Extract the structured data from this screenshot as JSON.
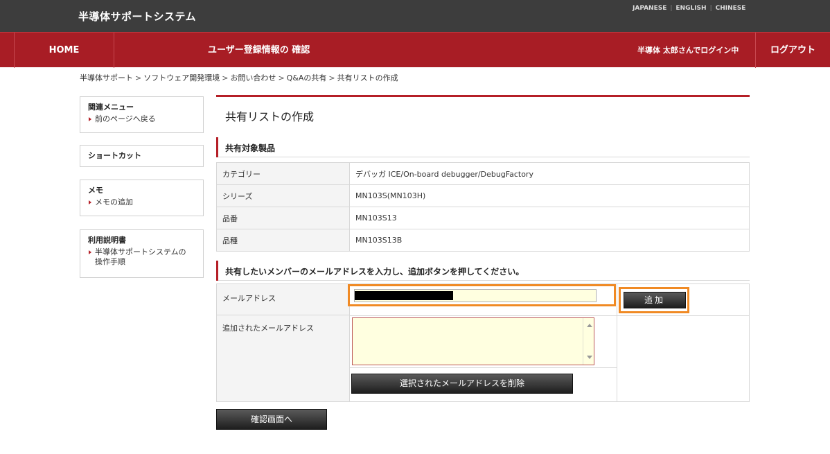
{
  "header": {
    "site_title": "半導体サポートシステム",
    "languages": [
      "JAPANESE",
      "ENGLISH",
      "CHINESE"
    ]
  },
  "nav": {
    "home": "HOME",
    "registration": "ユーザー登録情報の 確認",
    "user_status": "半導体 太郎さんでログイン中",
    "logout": "ログアウト"
  },
  "breadcrumb": [
    "半導体サポート",
    "ソフトウェア開発環境",
    "お問い合わせ",
    "Q&Aの共有",
    "共有リストの作成"
  ],
  "sidebar": {
    "related": {
      "title": "関連メニュー",
      "link": "前のページへ戻る"
    },
    "shortcut": {
      "title": "ショートカット"
    },
    "memo": {
      "title": "メモ",
      "link": "メモの追加"
    },
    "manual": {
      "title": "利用説明書",
      "link": "半導体サポートシステムの操作手順"
    }
  },
  "main": {
    "page_title": "共有リストの作成",
    "product_section": "共有対象製品",
    "products": [
      {
        "label": "カテゴリー",
        "value": "デバッガ  ICE/On-board debugger/DebugFactory"
      },
      {
        "label": "シリーズ",
        "value": "MN103S(MN103H)"
      },
      {
        "label": "品番",
        "value": "MN103S13"
      },
      {
        "label": "品種",
        "value": "MN103S13B"
      }
    ],
    "member_section": "共有したいメンバーのメールアドレスを入力し、追加ボタンを押してください。",
    "email_label": "メールアドレス",
    "added_label": "追加されたメールアドレス",
    "add_button": "追加",
    "delete_button": "選択されたメールアドレスを削除",
    "confirm_button": "確認画面へ"
  }
}
